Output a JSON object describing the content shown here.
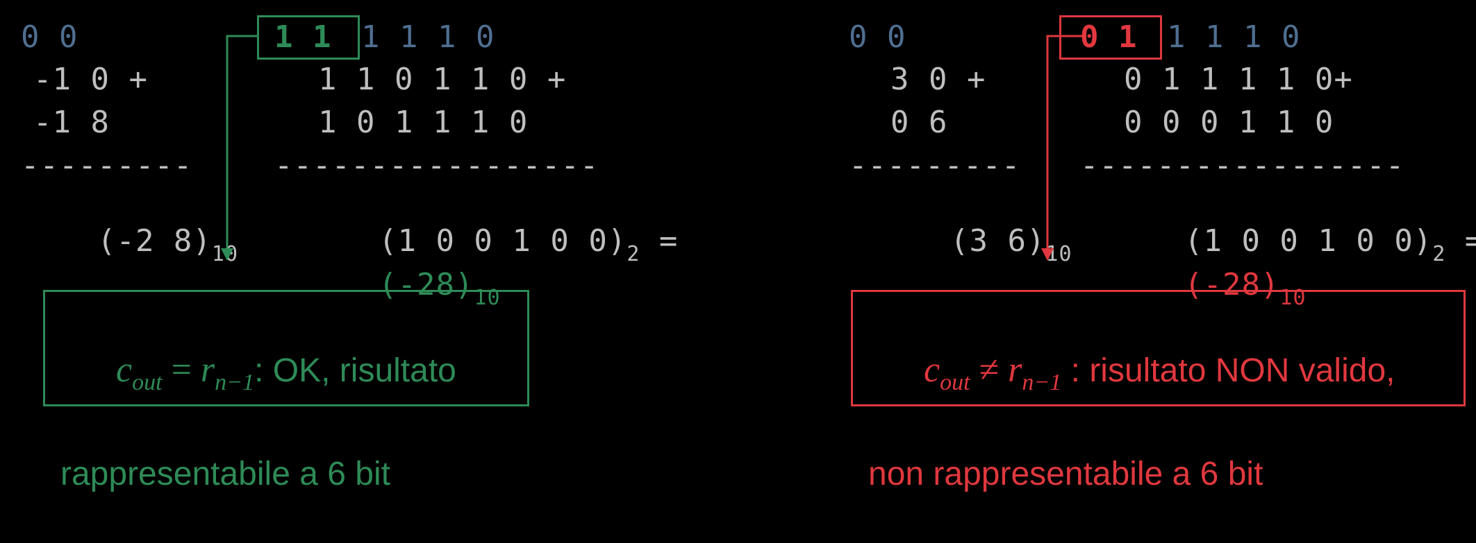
{
  "left": {
    "carry_bits": "0 0",
    "highlight_bits": "1 1",
    "carry_rest": "1 1 1 0",
    "dec_op1": "-1 0 +",
    "dec_op2": "-1 8",
    "dec_dashes": "---------",
    "dec_result": "(-2 8)",
    "dec_result_base": "10",
    "bin_op1": "1 1 0 1 1 0 +",
    "bin_op2": "1 0 1 1 1 0",
    "bin_dashes": "-----------------",
    "bin_result": "(1 0 0 1 0 0)",
    "bin_result_base": "2",
    "bin_equals": "=",
    "bin_decoded": "(-28)",
    "bin_decoded_base": "10",
    "note_c": "c",
    "note_c_sub": "out",
    "note_rel": "=",
    "note_r": "r",
    "note_r_sub": "n−1",
    "note_line1": ": OK, risultato",
    "note_line2": "rappresentabile a 6 bit",
    "color": "#2e8b57"
  },
  "right": {
    "carry_bits": "0 0",
    "highlight_bits": "0 1",
    "carry_rest": "1 1 1 0",
    "dec_op1": "3 0 +",
    "dec_op2": "0 6",
    "dec_dashes": "---------",
    "dec_result": "(3 6)",
    "dec_result_base": "10",
    "bin_op1": "0 1 1 1 1 0+",
    "bin_op2": "0 0 0 1 1 0",
    "bin_dashes": "-----------------",
    "bin_result": "(1 0 0 1 0 0)",
    "bin_result_base": "2",
    "bin_equals": "=",
    "bin_decoded": "(-28)",
    "bin_decoded_base": "10",
    "note_c": "c",
    "note_c_sub": "out",
    "note_rel": "≠",
    "note_r": "r",
    "note_r_sub": "n−1",
    "note_line1": " : risultato NON valido,",
    "note_line2": "non rappresentabile a 6 bit",
    "color": "#e0383e"
  }
}
